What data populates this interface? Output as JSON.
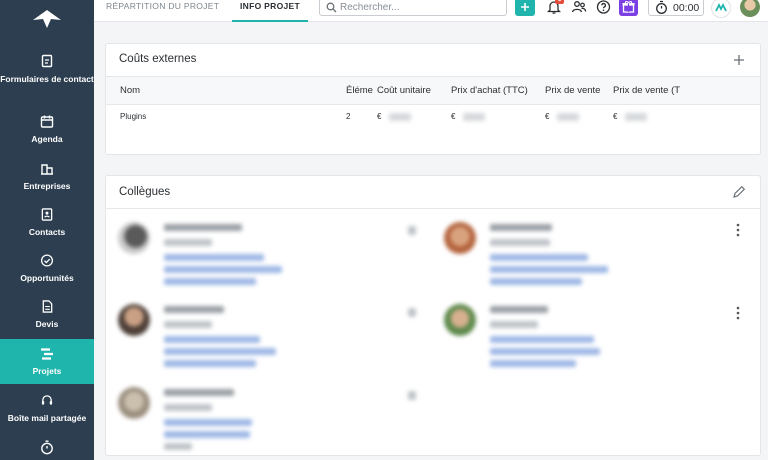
{
  "sidebar": {
    "items": [
      {
        "label": "Formulaires de contact",
        "icon": "clipboard-icon",
        "active": false
      },
      {
        "label": "Agenda",
        "icon": "calendar-icon",
        "active": false
      },
      {
        "label": "Entreprises",
        "icon": "buildings-icon",
        "active": false
      },
      {
        "label": "Contacts",
        "icon": "contact-card-icon",
        "active": false
      },
      {
        "label": "Opportunités",
        "icon": "check-circle-icon",
        "active": false
      },
      {
        "label": "Devis",
        "icon": "document-icon",
        "active": false
      },
      {
        "label": "Projets",
        "icon": "projects-bars-icon",
        "active": true
      },
      {
        "label": "Boîte mail partagée",
        "icon": "headset-icon",
        "active": false
      },
      {
        "label": "",
        "icon": "stopwatch-icon",
        "active": false
      }
    ]
  },
  "topbar": {
    "tabs": [
      {
        "label": "RÉPARTITION DU PROJET",
        "active": false
      },
      {
        "label": "INFO PROJET",
        "active": true
      }
    ],
    "search_placeholder": "Rechercher...",
    "notification_count": "1",
    "timer": "00:00"
  },
  "external_costs": {
    "title": "Coûts externes",
    "columns": [
      "Nom",
      "Éléme",
      "Coût unitaire",
      "Prix d'achat (TTC)",
      "Prix de vente",
      "Prix de vente (T"
    ],
    "rows": [
      {
        "name": "Plugins",
        "elements": "2",
        "currency": [
          "€",
          "€",
          "€",
          "€"
        ]
      }
    ]
  },
  "colleagues": {
    "title": "Collègues"
  },
  "colors": {
    "sidebar": "#2c3e50",
    "accent": "#1fb5ad",
    "gift": "#7b3fe4",
    "notification": "#e74c3c"
  }
}
